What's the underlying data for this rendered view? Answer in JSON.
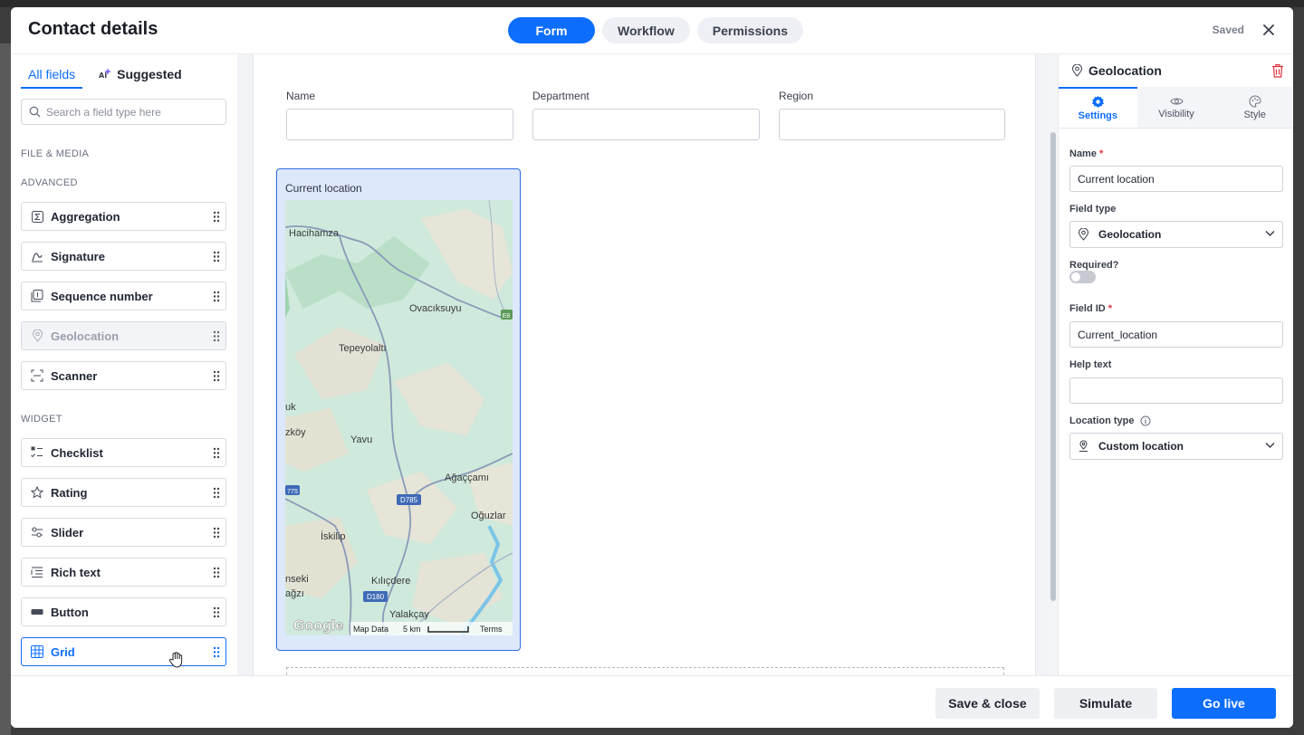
{
  "header": {
    "title": "Contact details",
    "tabs": [
      {
        "label": "Form",
        "active": true
      },
      {
        "label": "Workflow",
        "active": false
      },
      {
        "label": "Permissions",
        "active": false
      }
    ],
    "status": "Saved"
  },
  "sidebar": {
    "tabs": {
      "all_fields": "All fields",
      "suggested": "Suggested"
    },
    "search_placeholder": "Search a field type here",
    "sections": {
      "file_media": "FILE & MEDIA",
      "advanced": "ADVANCED",
      "widget": "WIDGET"
    },
    "advanced_items": [
      {
        "label": "Aggregation",
        "icon": "sigma-icon"
      },
      {
        "label": "Signature",
        "icon": "signature-icon"
      },
      {
        "label": "Sequence number",
        "icon": "sequence-icon"
      },
      {
        "label": "Geolocation",
        "icon": "location-pin-icon",
        "disabled": true
      },
      {
        "label": "Scanner",
        "icon": "scanner-icon"
      }
    ],
    "widget_items": [
      {
        "label": "Checklist",
        "icon": "checklist-icon"
      },
      {
        "label": "Rating",
        "icon": "star-icon"
      },
      {
        "label": "Slider",
        "icon": "slider-icon"
      },
      {
        "label": "Rich text",
        "icon": "rich-text-icon"
      },
      {
        "label": "Button",
        "icon": "button-icon"
      },
      {
        "label": "Grid",
        "icon": "grid-icon",
        "selected": true
      }
    ]
  },
  "form": {
    "fields": [
      {
        "label": "Name",
        "value": ""
      },
      {
        "label": "Department",
        "value": ""
      },
      {
        "label": "Region",
        "value": ""
      }
    ],
    "geo_field_label": "Current location",
    "map": {
      "places": [
        "Hacihamza",
        "Ovacıksuyu",
        "Tepeyolaltı",
        "uk",
        "zköy",
        "Yavu",
        "Ağaççamı",
        "Oğuzlar",
        "İskilip",
        "nseki",
        "ağzı",
        "Kılıçdere",
        "Yalakçay"
      ],
      "road_shields": [
        "E8",
        "775",
        "D785",
        "D180"
      ],
      "attribution": {
        "logo": "Google",
        "map_data": "Map Data",
        "scale": "5 km",
        "terms": "Terms"
      }
    }
  },
  "panel": {
    "title": "Geolocation",
    "tabs": [
      {
        "label": "Settings",
        "icon": "gear-icon",
        "active": true
      },
      {
        "label": "Visibility",
        "icon": "eye-icon",
        "active": false
      },
      {
        "label": "Style",
        "icon": "palette-icon",
        "active": false
      }
    ],
    "name_label": "Name",
    "name_value": "Current location",
    "field_type_label": "Field type",
    "field_type_value": "Geolocation",
    "required_label": "Required?",
    "required_on": false,
    "field_id_label": "Field ID",
    "field_id_value": "Current_location",
    "help_text_label": "Help text",
    "help_text_value": "",
    "location_type_label": "Location type",
    "location_type_value": "Custom location",
    "required_marker": "*"
  },
  "footer": {
    "save_close": "Save & close",
    "simulate": "Simulate",
    "go_live": "Go live"
  },
  "colors": {
    "accent": "#0d6efd",
    "danger": "#e0323c"
  }
}
